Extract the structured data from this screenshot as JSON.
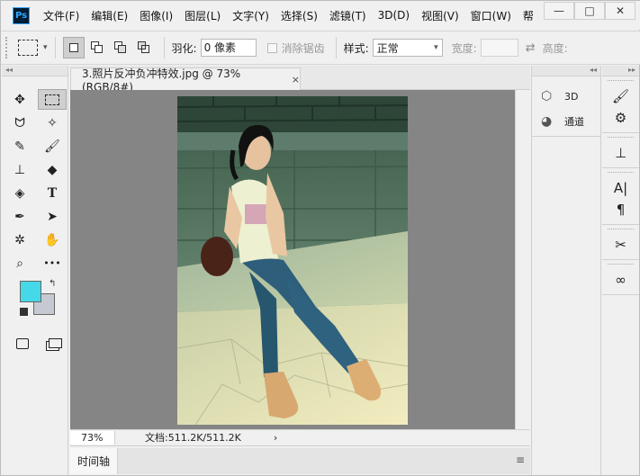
{
  "menubar": {
    "logo": "Ps",
    "items": [
      "文件(F)",
      "编辑(E)",
      "图像(I)",
      "图层(L)",
      "文字(Y)",
      "选择(S)",
      "滤镜(T)",
      "3D(D)",
      "视图(V)",
      "窗口(W)",
      "帮"
    ],
    "window_controls": {
      "minimize": "—",
      "maximize": "□",
      "close": "✕"
    }
  },
  "options": {
    "feather_label": "羽化:",
    "feather_value": "0 像素",
    "antialias_label": "消除锯齿",
    "style_label": "样式:",
    "style_value": "正常",
    "width_label": "宽度:",
    "height_label": "高度:"
  },
  "tools": {
    "collapse": "◂◂",
    "foreground_color": "#45d8e8",
    "background_color": "#c7c9d2",
    "items": [
      {
        "name": "move-tool",
        "glyph": "✥"
      },
      {
        "name": "rect-marquee-tool",
        "glyph": "⬚"
      },
      {
        "name": "lasso-tool",
        "glyph": "ᗢ"
      },
      {
        "name": "magic-wand-tool",
        "glyph": "✧"
      },
      {
        "name": "eyedropper-tool",
        "glyph": "✎"
      },
      {
        "name": "brush-tool",
        "glyph": "🖌"
      },
      {
        "name": "stamp-tool",
        "glyph": "⊥"
      },
      {
        "name": "eraser-tool",
        "glyph": "◆"
      },
      {
        "name": "paint-bucket-tool",
        "glyph": "◈"
      },
      {
        "name": "type-tool",
        "glyph": "T"
      },
      {
        "name": "pen-tool",
        "glyph": "✒"
      },
      {
        "name": "path-select-tool",
        "glyph": "➤"
      },
      {
        "name": "custom-shape-tool",
        "glyph": "✲"
      },
      {
        "name": "hand-tool",
        "glyph": "✋"
      },
      {
        "name": "zoom-tool",
        "glyph": "⌕"
      },
      {
        "name": "more-tools",
        "glyph": "•••"
      }
    ]
  },
  "document": {
    "tab_title": "3.照片反冲负冲特效.jpg @ 73%(RGB/8#)",
    "tab_close": "×",
    "zoom": "73%",
    "doc_info": "文档:511.2K/511.2K",
    "status_arrow": "›"
  },
  "timeline": {
    "tab_label": "时间轴",
    "menu_icon": "≡"
  },
  "panels": {
    "collapse": "◂◂",
    "expand": "▸▸",
    "items": [
      {
        "label": "3D",
        "icon": "cube-icon",
        "glyph": "⬡"
      },
      {
        "label": "通道",
        "icon": "channels-icon",
        "glyph": "◕"
      }
    ]
  },
  "icon_strip": {
    "groups": [
      [
        {
          "name": "brush-settings-icon",
          "glyph": "🖌"
        },
        {
          "name": "adjustments-icon",
          "glyph": "⚙"
        }
      ],
      [
        {
          "name": "clone-source-icon",
          "glyph": "⊥"
        }
      ],
      [
        {
          "name": "character-icon",
          "glyph": "A|"
        },
        {
          "name": "paragraph-icon",
          "glyph": "¶"
        }
      ],
      [
        {
          "name": "tool-presets-icon",
          "glyph": "✂"
        }
      ],
      [
        {
          "name": "libraries-icon",
          "glyph": "∞"
        }
      ]
    ]
  }
}
